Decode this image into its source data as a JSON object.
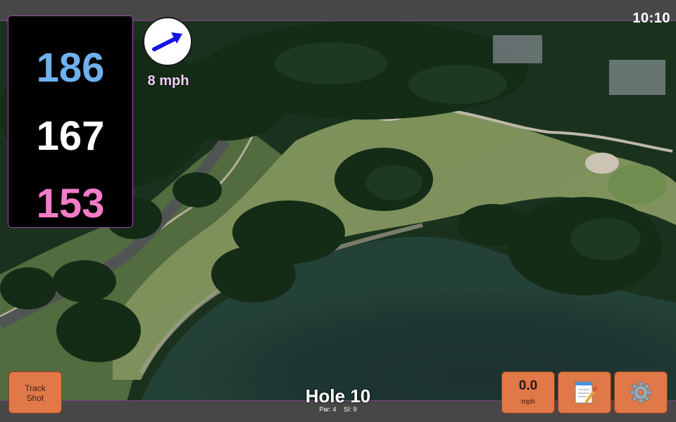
{
  "status_bar": {
    "time": "10:10"
  },
  "distances": {
    "back": "186",
    "middle": "167",
    "front": "153",
    "back_color": "#6fb1ee",
    "middle_color": "#ffffff",
    "front_color": "#f37cc6"
  },
  "wind": {
    "speed": "8 mph",
    "arrow_icon": "wind-arrow-icon",
    "arrow_color": "#1414e6"
  },
  "hole": {
    "title": "Hole 10",
    "par": "Par: 4",
    "stroke_index": "SI: 9"
  },
  "buttons": {
    "track_shot_line1": "Track",
    "track_shot_line2": "Shot",
    "speed_value": "0.0",
    "speed_unit": "mph",
    "notes_icon": "notepad-icon",
    "settings_icon": "gear-icon",
    "button_color": "#e07847"
  },
  "map": {
    "type": "satellite-golf-hole",
    "border_color": "#7d3f86"
  }
}
